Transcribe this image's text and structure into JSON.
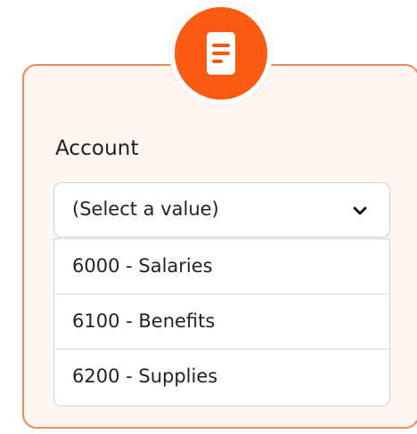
{
  "form": {
    "account_label": "Account"
  },
  "select": {
    "placeholder_value": "(Select a value)",
    "icon": "chevron-down-icon"
  },
  "options": [
    {
      "label": "6000 - Salaries"
    },
    {
      "label": "6100 - Benefits"
    },
    {
      "label": "6200 - Supplies"
    }
  ],
  "header_icon": "document-icon",
  "colors": {
    "accent": "#fa5b12",
    "card_border": "#ee8a57",
    "card_background": "#fdf6f1"
  }
}
